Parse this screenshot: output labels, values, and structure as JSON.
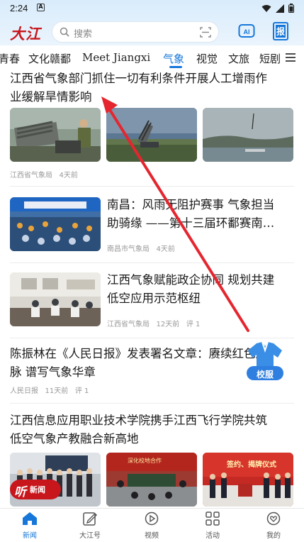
{
  "status": {
    "time": "2:24",
    "notif": "A"
  },
  "header": {
    "logo": "大江",
    "search_placeholder": "搜索",
    "ai_label": "AI",
    "paper_label": "报"
  },
  "tabs": [
    {
      "label": "青春"
    },
    {
      "label": "文化赣鄱"
    },
    {
      "label": "Meet Jiangxi"
    },
    {
      "label": "气象"
    },
    {
      "label": "视觉"
    },
    {
      "label": "文旅"
    },
    {
      "label": "短剧"
    }
  ],
  "feed": {
    "a1": {
      "title_l1": "江西省气象部门抓住一切有利条件开展人工增雨作",
      "title_l2": "业缓解旱情影响",
      "source": "江西省气象局",
      "time": "4天前"
    },
    "a2": {
      "title_l1": "南昌：风雨无阻护赛事 气象担当",
      "title_l2": "助骑缘 ——第十三届环鄱赛南…",
      "source": "南昌市气象局",
      "time": "4天前"
    },
    "a3": {
      "title_l1": "江西气象赋能政企协同 规划共建",
      "title_l2": "低空应用示范枢纽",
      "source": "江西省气象局",
      "time": "12天前",
      "comments": "评 1"
    },
    "a4": {
      "title_l1": "陈振林在《人民日报》发表署名文章：赓续红色血",
      "title_l2": "脉 谱写气象华章",
      "source": "人民日报",
      "time": "11天前",
      "comments": "评 1"
    },
    "a5": {
      "title_l1": "江西信息应用职业技术学院携手江西飞行学院共筑",
      "title_l2": "低空气象产教融合新高地"
    },
    "a5_img2_banner": "深化校地合作",
    "a5_img3_banner": "签约、揭牌仪式"
  },
  "floats": {
    "school_badge": "校服",
    "listen_label": "听新闻",
    "listen_char": "听",
    "listen_text": "新闻"
  },
  "nav": [
    {
      "label": "新闻"
    },
    {
      "label": "大江号"
    },
    {
      "label": "视频"
    },
    {
      "label": "活动"
    },
    {
      "label": "我的"
    }
  ],
  "colors": {
    "brand_red": "#c8161d",
    "accent_blue": "#1677d9",
    "arrow_red": "#e5262f"
  }
}
